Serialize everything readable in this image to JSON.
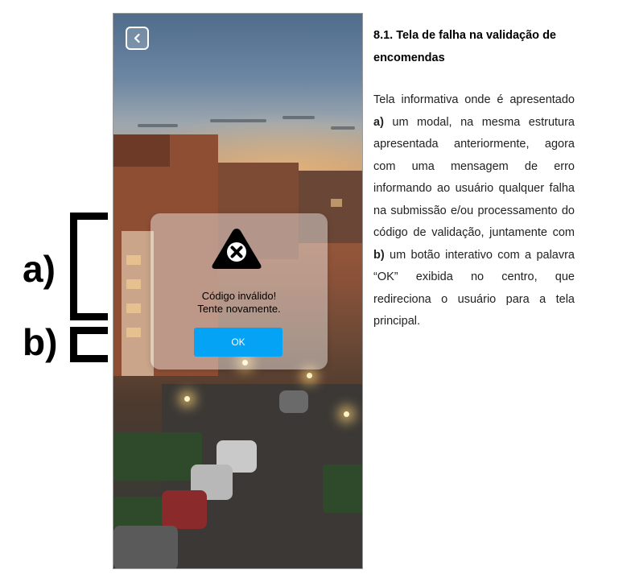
{
  "annotations": {
    "a_label": "a)",
    "b_label": "b)"
  },
  "phone": {
    "modal": {
      "icon": "error-x-triangle-icon",
      "message_line1": "Código inválido!",
      "message_line2": "Tente novamente.",
      "button_label": "OK"
    },
    "back_icon": "chevron-left-icon"
  },
  "document": {
    "title": "8.1. Tela de falha na validação de encomendas",
    "body": {
      "p1": "Tela informativa onde é apresentado ",
      "a_ref": "a)",
      "p2": " um modal, na mesma estrutura apresentada anteriormente, agora com uma mensagem de erro informando ao usuário qualquer falha na submissão e/ou processamento do código de validação, juntamente com ",
      "b_ref": "b)",
      "p3": " um botão interativo com a palavra “OK” exibida no centro, que redireciona o usuário para a tela principal."
    }
  },
  "colors": {
    "ok_button": "#04a3f5",
    "modal_bg": "rgba(255,255,255,0.42)",
    "annotation": "#000000"
  }
}
